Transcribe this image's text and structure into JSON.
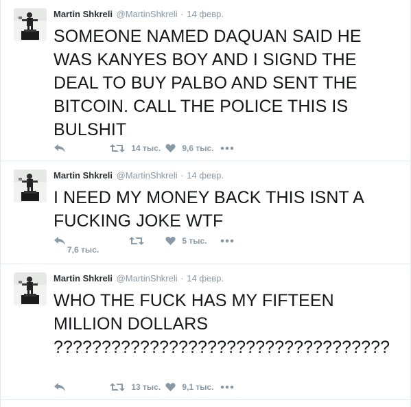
{
  "colors": {
    "text": "#14171a",
    "muted": "#8899a6",
    "border": "#e1e8ed"
  },
  "tweets": [
    {
      "fullname": "Martin Shkreli",
      "handle": "@MartinShkreli",
      "separator": "·",
      "time": "14 февр.",
      "text": "SOMEONE NAMED DAQUAN SAID HE WAS KANYES BOY AND I SIGND THE DEAL TO BUY PALBO AND SENT THE BITCOIN. CALL THE POLICE THIS IS BULSHIT",
      "retweets": "14 тыс.",
      "likes": "9,6 тыс."
    },
    {
      "fullname": "Martin Shkreli",
      "handle": "@MartinShkreli",
      "separator": "·",
      "time": "14 февр.",
      "text": "I NEED MY MONEY BACK THIS ISNT A FUCKING JOKE WTF",
      "retweets": "7,6 тыс.",
      "likes": "5 тыс."
    },
    {
      "fullname": "Martin Shkreli",
      "handle": "@MartinShkreli",
      "separator": "·",
      "time": "14 февр.",
      "text": "WHO THE FUCK HAS MY FIFTEEN MILLION DOLLARS ???????????????????????????????????",
      "retweets": "13 тыс.",
      "likes": "9,1 тыс."
    }
  ],
  "icons": {
    "reply": "reply-arrow-icon",
    "retweet": "retweet-icon",
    "like": "heart-icon",
    "more": "more-dots-icon",
    "avatar": "profile-picture"
  }
}
